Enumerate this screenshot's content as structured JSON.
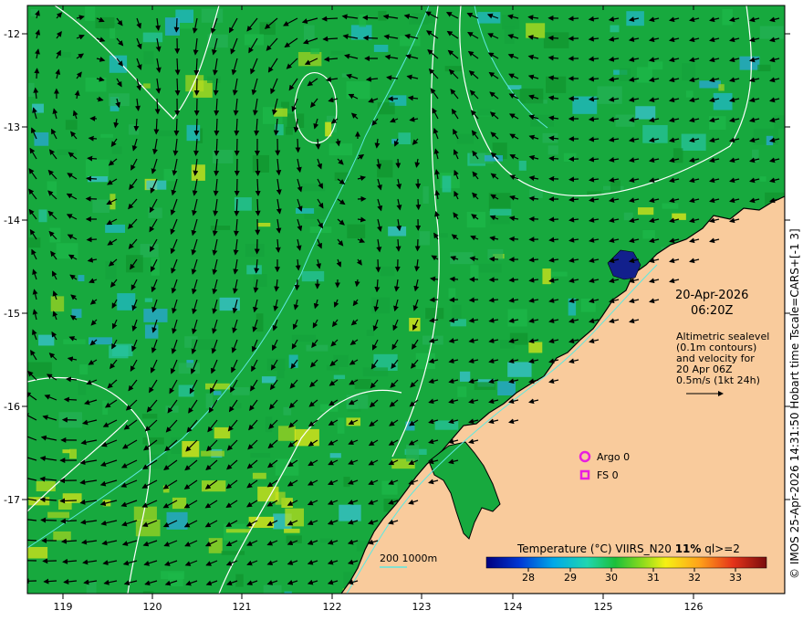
{
  "map": {
    "lon_ticks": [
      "119",
      "120",
      "121",
      "122",
      "123",
      "124",
      "125",
      "126"
    ],
    "lat_ticks": [
      "-12",
      "-13",
      "-14",
      "-15",
      "-16",
      "-17"
    ],
    "date": "20-Apr-2026",
    "time": "06:20Z",
    "note_lines": [
      "Altimetric sealevel",
      "(0.1m contours)",
      "and velocity for",
      "20 Apr 06Z",
      "0.5m/s (1kt 24h)"
    ],
    "argo_label": "Argo 0",
    "fs_label": "FS 0",
    "depth_label": "200  1000m",
    "colorbar_title_pre": "Temperature (°C) VIIRS_N20 ",
    "colorbar_title_bold": "11%",
    "colorbar_title_post": " ql>=2",
    "colorbar_ticks": [
      "28",
      "29",
      "30",
      "31",
      "32",
      "33"
    ],
    "credit": "© IMOS 25-Apr-2026 14:31:50 Hobart time Tscale=CARS+[-1 3]",
    "colors": {
      "land": "#f9cb9c",
      "ocean_base": "#17a93e",
      "cool": "#1fb6c9",
      "warm": "#c8e01d",
      "contour": "#ffffff",
      "isobath": "#5fe8e0",
      "marker": "#e81ee0"
    }
  }
}
